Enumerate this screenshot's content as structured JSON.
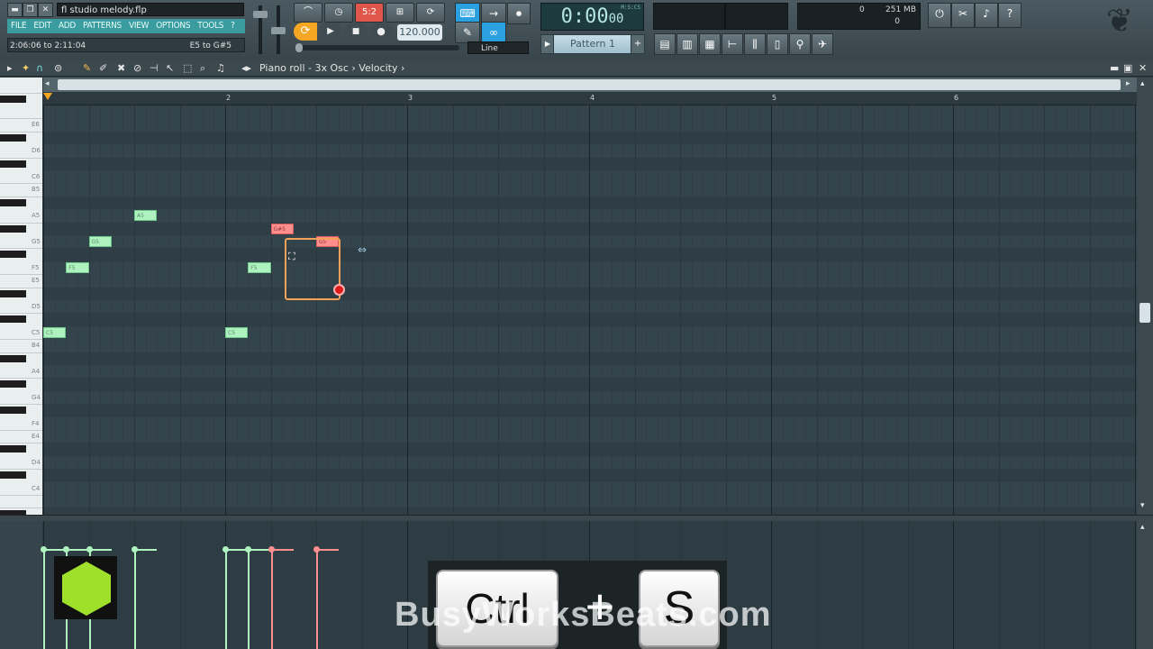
{
  "window": {
    "file_title": "fl studio melody.flp"
  },
  "menu": [
    "FILE",
    "EDIT",
    "ADD",
    "PATTERNS",
    "VIEW",
    "OPTIONS",
    "TOOLS",
    "?"
  ],
  "hint": {
    "left": "2:06:06 to 2:11:04",
    "right": "E5 to G#5"
  },
  "transport": {
    "time": "0:00",
    "time_small": "00",
    "time_mode": "M:S:CS",
    "tempo": "120.000",
    "pattern": "Pattern 1",
    "snap": "Line",
    "numbox": "5:2"
  },
  "cpu": {
    "value": "0",
    "mem": "251 MB",
    "poly": "0"
  },
  "pianoroll": {
    "path": "Piano roll - 3x Osc › Velocity ›"
  },
  "ruler": {
    "bars": [
      "2",
      "3",
      "4",
      "5",
      "6"
    ]
  },
  "keys": {
    "labels": [
      "E6",
      "D6",
      "C6",
      "B5",
      "A5",
      "G5",
      "F5",
      "E5",
      "D5",
      "C5",
      "B4",
      "A4",
      "G4",
      "F4",
      "E4",
      "D4",
      "C4"
    ]
  },
  "notes": [
    {
      "label": "C5",
      "bar": 1.0,
      "len": 0.125,
      "pitch": "C5"
    },
    {
      "label": "F5",
      "bar": 1.125,
      "len": 0.125,
      "pitch": "F5"
    },
    {
      "label": "G5",
      "bar": 1.25,
      "len": 0.125,
      "pitch": "G5"
    },
    {
      "label": "A5",
      "bar": 1.5,
      "len": 0.125,
      "pitch": "A5"
    },
    {
      "label": "C5",
      "bar": 2.0,
      "len": 0.125,
      "pitch": "C5"
    },
    {
      "label": "F5",
      "bar": 2.125,
      "len": 0.125,
      "pitch": "F5"
    },
    {
      "label": "G#5",
      "bar": 2.25,
      "len": 0.125,
      "pitch": "G#5",
      "selected": true
    },
    {
      "label": "G5",
      "bar": 2.5,
      "len": 0.125,
      "pitch": "G5",
      "selected": true
    }
  ],
  "overlay": {
    "key1": "Ctrl",
    "plus": "+",
    "key2": "S",
    "watermark": "BusyWorksBeats.com"
  },
  "colors": {
    "note": "#aef3bf",
    "note_selected": "#ff8f8f",
    "accent": "#3a9c9e",
    "selection": "#f5a15a"
  }
}
